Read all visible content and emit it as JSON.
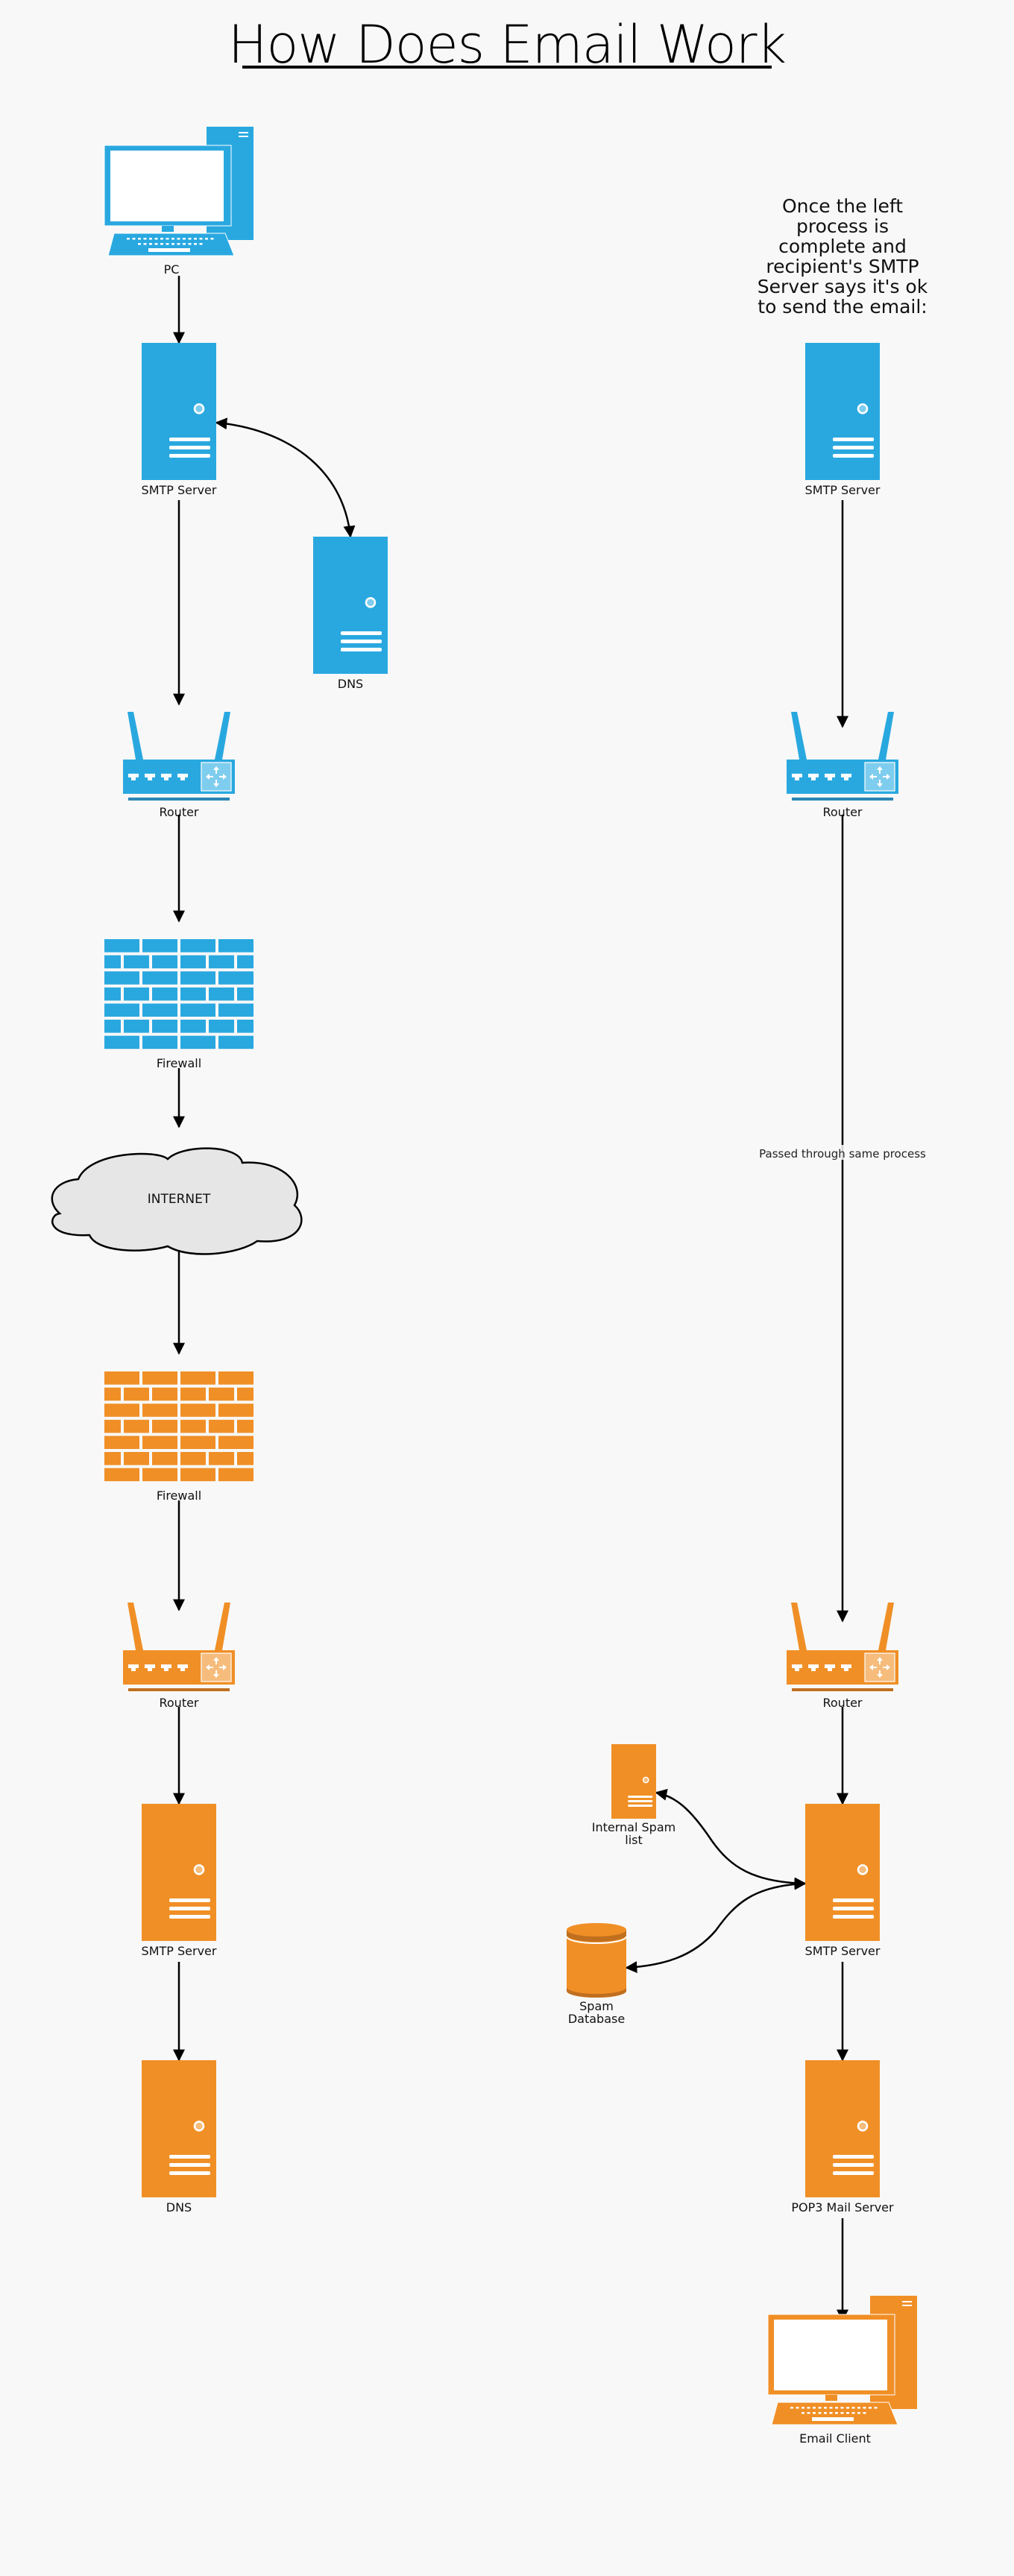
{
  "title": "How Does Email Work",
  "colors": {
    "sender": "#29a8e0",
    "sender_light": "#7fcdee",
    "sender_dark": "#2a86b5",
    "recipient": "#f08f26",
    "recipient_light": "#f5bc7c",
    "recipient_dark": "#c06f1f",
    "cloud_fill": "#e6e6e6",
    "background": "#f8f8f8"
  },
  "nodes": {
    "pc": {
      "label": "PC",
      "icon": "desktop-computer-icon"
    },
    "smtp_left_blue": {
      "label": "SMTP Server",
      "icon": "server-icon"
    },
    "dns_blue": {
      "label": "DNS",
      "icon": "server-icon"
    },
    "router_left_blue": {
      "label": "Router",
      "icon": "router-icon"
    },
    "firewall_blue": {
      "label": "Firewall",
      "icon": "firewall-icon"
    },
    "internet": {
      "label": "INTERNET",
      "icon": "cloud-icon"
    },
    "firewall_orange": {
      "label": "Firewall",
      "icon": "firewall-icon"
    },
    "router_left_orange": {
      "label": "Router",
      "icon": "router-icon"
    },
    "smtp_left_orange": {
      "label": "SMTP Server",
      "icon": "server-icon"
    },
    "dns_orange": {
      "label": "DNS",
      "icon": "server-icon"
    },
    "smtp_right_blue": {
      "label": "SMTP Server",
      "icon": "server-icon"
    },
    "router_right_blue": {
      "label": "Router",
      "icon": "router-icon"
    },
    "router_right_orange": {
      "label": "Router",
      "icon": "router-icon"
    },
    "internal_spam_list": {
      "label_lines": [
        "Internal Spam",
        "list"
      ],
      "icon": "server-icon"
    },
    "smtp_right_orange": {
      "label": "SMTP Server",
      "icon": "server-icon"
    },
    "spam_database": {
      "label_lines": [
        "Spam",
        "Database"
      ],
      "icon": "database-icon"
    },
    "pop3": {
      "label": "POP3 Mail Server",
      "icon": "server-icon"
    },
    "email_client": {
      "label": "Email Client",
      "icon": "desktop-computer-icon"
    }
  },
  "note_lines": [
    "Once the left",
    "process is",
    "complete and",
    "recipient's SMTP",
    "Server says it's ok",
    "to send the email:"
  ],
  "edge_label": "Passed through same process",
  "edges": [
    {
      "from": "pc",
      "to": "smtp_left_blue"
    },
    {
      "from": "smtp_left_blue",
      "to": "dns_blue",
      "bidirectional": true
    },
    {
      "from": "smtp_left_blue",
      "to": "router_left_blue"
    },
    {
      "from": "router_left_blue",
      "to": "firewall_blue"
    },
    {
      "from": "firewall_blue",
      "to": "internet"
    },
    {
      "from": "internet",
      "to": "firewall_orange"
    },
    {
      "from": "firewall_orange",
      "to": "router_left_orange"
    },
    {
      "from": "router_left_orange",
      "to": "smtp_left_orange"
    },
    {
      "from": "smtp_left_orange",
      "to": "dns_orange"
    },
    {
      "from": "smtp_right_blue",
      "to": "router_right_blue"
    },
    {
      "from": "router_right_blue",
      "to": "router_right_orange",
      "label": "Passed through same process"
    },
    {
      "from": "router_right_orange",
      "to": "smtp_right_orange"
    },
    {
      "from": "smtp_right_orange",
      "to": "internal_spam_list",
      "bidirectional": true
    },
    {
      "from": "smtp_right_orange",
      "to": "spam_database",
      "bidirectional": true
    },
    {
      "from": "smtp_right_orange",
      "to": "pop3"
    },
    {
      "from": "pop3",
      "to": "email_client"
    }
  ]
}
